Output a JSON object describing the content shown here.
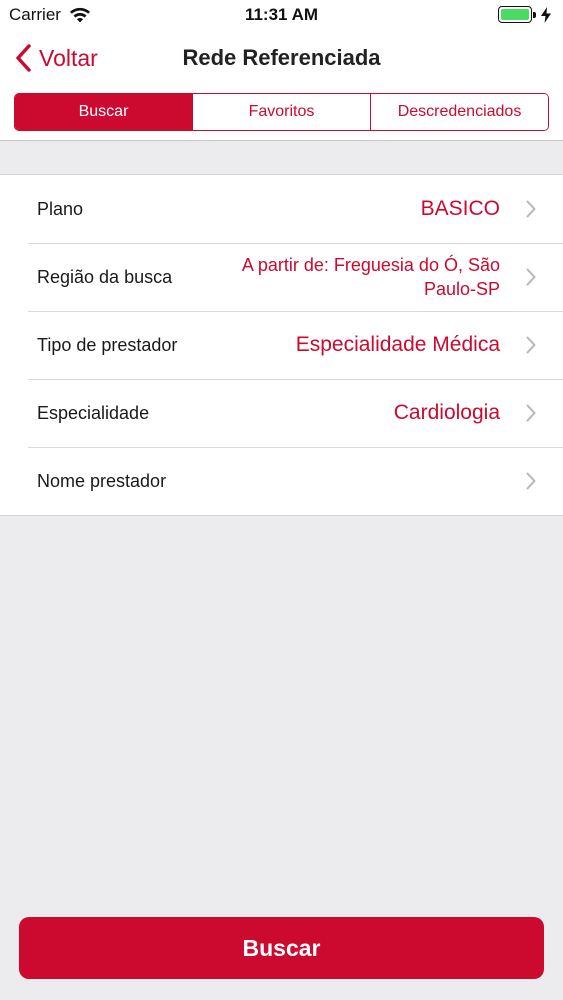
{
  "status_bar": {
    "carrier": "Carrier",
    "time": "11:31 AM",
    "wifi_icon": "wifi-icon",
    "battery_icon": "battery-icon",
    "charging_icon": "bolt-icon",
    "battery_level": 1.0
  },
  "nav": {
    "back_label": "Voltar",
    "back_icon": "chevron-left-icon",
    "title": "Rede Referenciada"
  },
  "tabs": [
    {
      "label": "Buscar",
      "active": true
    },
    {
      "label": "Favoritos",
      "active": false
    },
    {
      "label": "Descredenciados",
      "active": false
    }
  ],
  "form": {
    "rows": [
      {
        "label": "Plano",
        "value": "BASICO"
      },
      {
        "label": "Região da busca",
        "value": "A partir de: Freguesia do Ó, São Paulo-SP"
      },
      {
        "label": "Tipo de prestador",
        "value": "Especialidade Médica"
      },
      {
        "label": "Especialidade",
        "value": "Cardiologia"
      },
      {
        "label": "Nome prestador",
        "value": ""
      }
    ],
    "chevron_icon": "chevron-right-icon"
  },
  "search_button": {
    "label": "Buscar"
  },
  "colors": {
    "accent": "#cc0a2f",
    "background": "#ececee",
    "battery_green": "#4cd964"
  }
}
